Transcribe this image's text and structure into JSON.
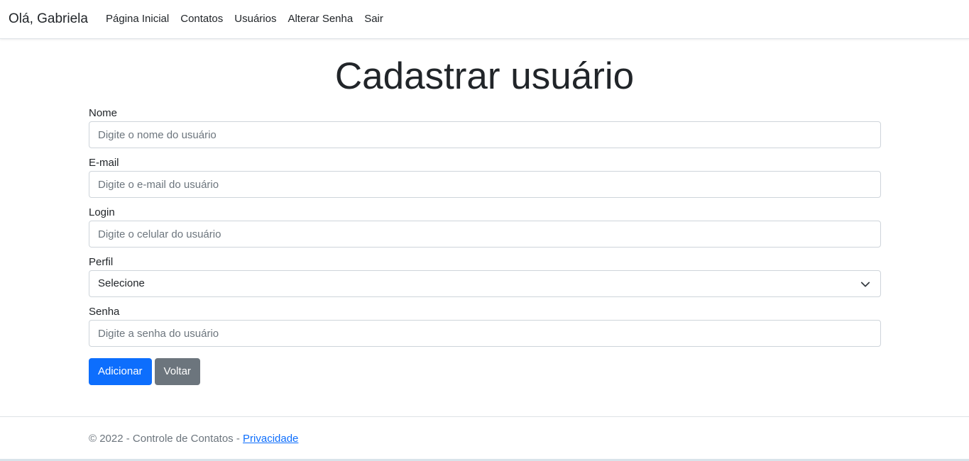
{
  "navbar": {
    "brand": "Olá, Gabriela",
    "links": [
      "Página Inicial",
      "Contatos",
      "Usuários",
      "Alterar Senha",
      "Sair"
    ]
  },
  "page": {
    "title": "Cadastrar usuário"
  },
  "form": {
    "nome": {
      "label": "Nome",
      "placeholder": "Digite o nome do usuário",
      "value": ""
    },
    "email": {
      "label": "E-mail",
      "placeholder": "Digite o e-mail do usuário",
      "value": ""
    },
    "login": {
      "label": "Login",
      "placeholder": "Digite o celular do usuário",
      "value": ""
    },
    "perfil": {
      "label": "Perfil",
      "selected": "Selecione",
      "icon": "chevron-down-icon"
    },
    "senha": {
      "label": "Senha",
      "placeholder": "Digite a senha do usuário",
      "value": ""
    },
    "add_label": "Adicionar",
    "back_label": "Voltar"
  },
  "footer": {
    "copyright": "© 2022 - Controle de Contatos - ",
    "privacy_link": "Privacidade"
  },
  "colors": {
    "primary": "#0d6efd",
    "secondary": "#6c757d",
    "border": "#ced4da",
    "text": "#212529"
  }
}
